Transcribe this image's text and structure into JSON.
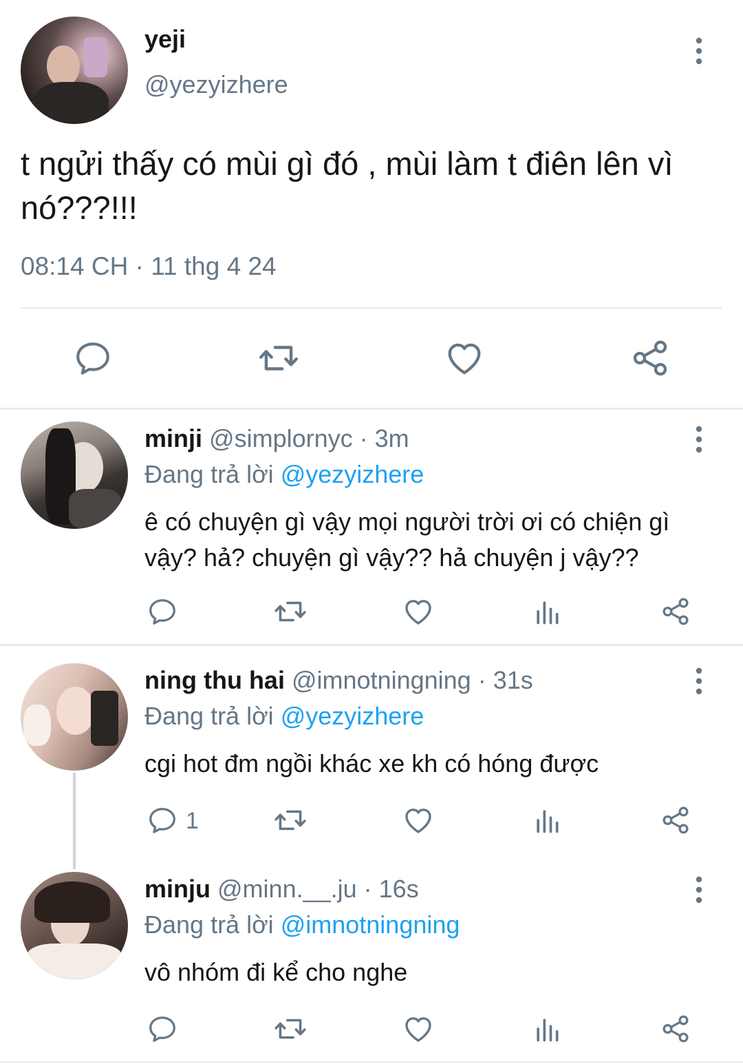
{
  "main_tweet": {
    "display_name": "yeji",
    "handle": "@yezyizhere",
    "text": "t ngửi thấy có mùi gì đó , mùi làm t điên lên vì nó???!!!",
    "timestamp": "08:14 CH · 11 thg 4 24"
  },
  "replies": [
    {
      "display_name": "minji",
      "handle": "@simplornyc",
      "time": "· 3m",
      "replying_prefix": "Đang trả lời",
      "replying_to": "@yezyizhere",
      "text_lines": [
        "ê có chuyện gì vậy mọi người trời ơi có chiện gì",
        "vậy? hả? chuyện gì vậy?? hả chuyện j vậy??"
      ],
      "reply_count": ""
    },
    {
      "display_name": "ning thu hai",
      "handle": "@imnotningning",
      "time": "· 31s",
      "replying_prefix": "Đang trả lời",
      "replying_to": "@yezyizhere",
      "text_lines": [
        "cgi hot đm ngồi khác xe kh có hóng được"
      ],
      "reply_count": "1"
    },
    {
      "display_name": "minju",
      "handle": "@minn.__.ju",
      "time": "· 16s",
      "replying_prefix": "Đang trả lời",
      "replying_to": "@imnotningning",
      "text_lines": [
        "vô nhóm đi kể cho nghe"
      ],
      "reply_count": ""
    }
  ],
  "colors": {
    "icon_grey": "#657786",
    "link_blue": "#1da1f2",
    "divider": "#e6ecf0"
  },
  "icons": [
    "more-vertical-icon",
    "reply-icon",
    "retweet-icon",
    "like-icon",
    "analytics-icon",
    "share-icon"
  ]
}
